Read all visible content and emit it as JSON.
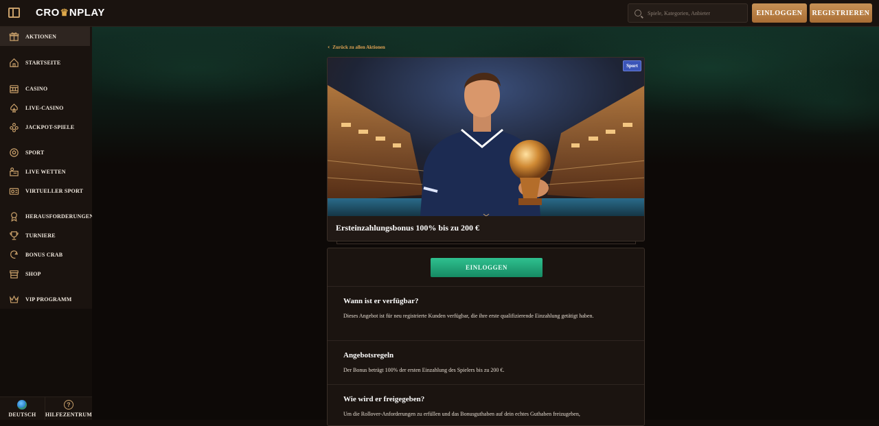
{
  "header": {
    "logo_left": "CRO",
    "logo_right": "NPLAY",
    "search_placeholder": "Spiele, Kategorien, Anbieter",
    "login_label": "EINLOGGEN",
    "register_label": "REGISTRIEREN"
  },
  "sidebar": {
    "items": [
      {
        "label": "AKTIONEN",
        "icon": "gift-icon",
        "active": true
      },
      {
        "label": "STARTSEITE",
        "icon": "home-icon"
      },
      {
        "label": "CASINO",
        "icon": "slot-machine-icon"
      },
      {
        "label": "LIVE-CASINO",
        "icon": "spade-icon"
      },
      {
        "label": "JACKPOT-SPIELE",
        "icon": "jackpot-icon"
      },
      {
        "label": "SPORT",
        "icon": "ball-icon"
      },
      {
        "label": "LIVE WETTEN",
        "icon": "live-bet-icon"
      },
      {
        "label": "VIRTUELLER SPORT",
        "icon": "virtual-sport-icon"
      },
      {
        "label": "HERAUSFORDERUNGEN",
        "icon": "medal-icon"
      },
      {
        "label": "TURNIERE",
        "icon": "trophy-icon"
      },
      {
        "label": "BONUS CRAB",
        "icon": "crab-icon"
      },
      {
        "label": "SHOP",
        "icon": "shop-icon"
      },
      {
        "label": "VIP PROGRAMM",
        "icon": "crown-icon"
      }
    ],
    "language_label": "DEUTSCH",
    "help_label": "HILFEZENTRUM"
  },
  "main": {
    "back_link": "Zurück zu allen Aktionen",
    "promo": {
      "tag": "Sport",
      "title": "Ersteinzahlungsbonus 100% bis zu 200 €"
    },
    "login_button": "EINLOGGEN",
    "sections": [
      {
        "title": "Wann ist er verfügbar?",
        "text": "Dieses Angebot ist für neu registrierte Kunden verfügbar, die ihre erste qualifizierende Einzahlung getätigt haben."
      },
      {
        "title": "Angebotsregeln",
        "text": "Der Bonus beträgt 100% der ersten Einzahlung des Spielers bis zu 200 €."
      },
      {
        "title": "Wie wird er freigegeben?",
        "text": "Um die Rollover-Anforderungen zu erfüllen und das Bonusguthaben auf dein echtes Guthaben freizugeben,"
      }
    ]
  },
  "colors": {
    "accent_gold": "#c79256",
    "accent_orange": "#e3a354",
    "cta_green": "#22a77a",
    "sport_tag": "#3b55b8",
    "sidebar_bg": "#1a130f"
  }
}
